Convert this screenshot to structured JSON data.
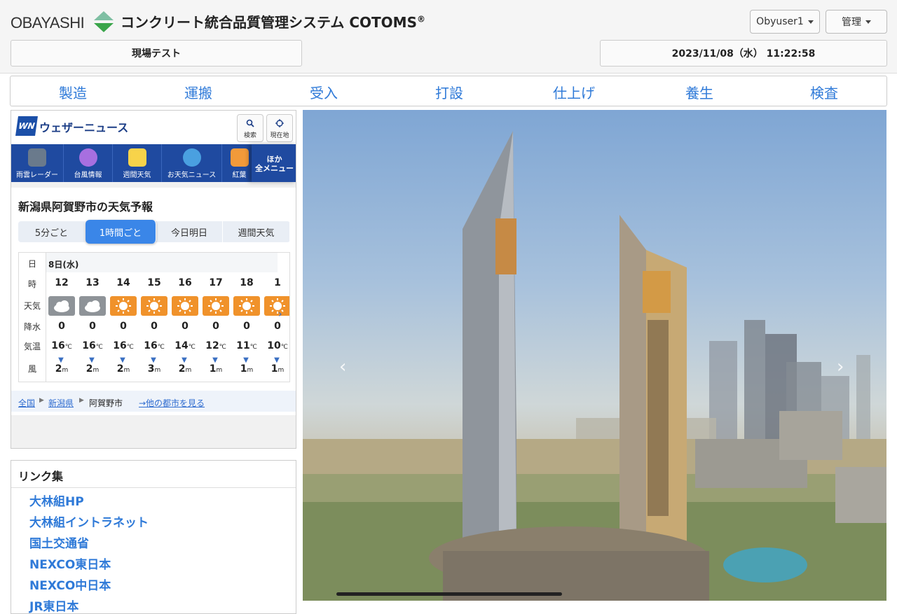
{
  "header": {
    "logo_text": "OBAYASHI",
    "app_title": "コンクリート統合品質管理システム COTOMS",
    "registered": "®",
    "user_menu": "Obyuser1",
    "admin_menu": "管理",
    "site_name": "現場テスト",
    "datetime": "2023/11/08（水） 11:22:58"
  },
  "process_nav": [
    "製造",
    "運搬",
    "受入",
    "打設",
    "仕上げ",
    "養生",
    "検査"
  ],
  "weather": {
    "brand_logo": "WN",
    "brand_name": "ウェザーニュース",
    "tools": {
      "search": "検索",
      "location": "現在地"
    },
    "menu": [
      "雨雲レーダー",
      "台風情報",
      "週間天気",
      "お天気ニュース",
      "紅葉"
    ],
    "menu_more_1": "ほか",
    "menu_more_2": "全メニュー",
    "forecast_title": "新潟県阿賀野市の天気予報",
    "tabs": [
      "5分ごと",
      "1時間ごと",
      "今日明日",
      "週間天気"
    ],
    "active_tab": 1,
    "row_labels": [
      "日",
      "時",
      "天気",
      "降水",
      "気温",
      "風"
    ],
    "day_label": "8日(水)",
    "hours": [
      {
        "hour": "12",
        "weather": "cloudy",
        "precip": "0",
        "temp": "16",
        "wind": "2"
      },
      {
        "hour": "13",
        "weather": "cloudy",
        "precip": "0",
        "temp": "16",
        "wind": "2"
      },
      {
        "hour": "14",
        "weather": "sunny",
        "precip": "0",
        "temp": "16",
        "wind": "2"
      },
      {
        "hour": "15",
        "weather": "sunny",
        "precip": "0",
        "temp": "16",
        "wind": "3"
      },
      {
        "hour": "16",
        "weather": "sunny",
        "precip": "0",
        "temp": "14",
        "wind": "2"
      },
      {
        "hour": "17",
        "weather": "sunny",
        "precip": "0",
        "temp": "12",
        "wind": "1"
      },
      {
        "hour": "18",
        "weather": "sunny",
        "precip": "0",
        "temp": "11",
        "wind": "1"
      },
      {
        "hour": "1",
        "weather": "sunny",
        "precip": "0",
        "temp": "10",
        "wind": "1"
      }
    ],
    "temp_unit": "℃",
    "wind_unit": "m",
    "breadcrumb": {
      "all": "全国",
      "pref": "新潟県",
      "city": "阿賀野市",
      "other": "→他の都市を見る"
    }
  },
  "links": {
    "title": "リンク集",
    "items": [
      "大林組HP",
      "大林組イントラネット",
      "国土交通省",
      "NEXCO東日本",
      "NEXCO中日本",
      "JR東日本"
    ]
  },
  "carousel": {
    "prev": "‹",
    "next": "›"
  },
  "colors": {
    "accent": "#2f7ad8",
    "wn_blue": "#1f4aa0",
    "sunny": "#f0922b",
    "cloudy": "#8e9398"
  }
}
